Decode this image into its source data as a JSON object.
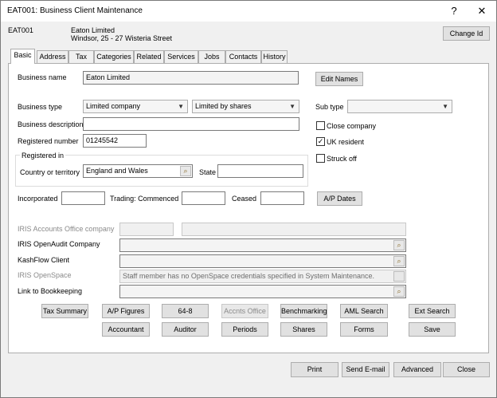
{
  "window": {
    "title": "EAT001: Business Client Maintenance",
    "help": "?",
    "close": "✕"
  },
  "header": {
    "code": "EAT001",
    "name": "Eaton Limited",
    "address": "Windsor, 25 - 27 Wisteria Street",
    "change_id": "Change Id"
  },
  "tabs": [
    "Basic",
    "Address",
    "Tax",
    "Categories",
    "Related",
    "Services",
    "Jobs",
    "Contacts",
    "History"
  ],
  "basic": {
    "business_name_label": "Business name",
    "business_name": "Eaton Limited",
    "edit_names": "Edit Names",
    "business_type_label": "Business type",
    "business_type": "Limited company",
    "business_subtype": "Limited by shares",
    "sub_type_label": "Sub type",
    "sub_type": "",
    "description_label": "Business description",
    "description": "",
    "reg_number_label": "Registered number",
    "reg_number": "01245542",
    "close_company": "Close company",
    "uk_resident": "UK resident",
    "struck_off": "Struck off",
    "registered_in_label": "Registered in",
    "country_label": "Country or territory",
    "country": "England and Wales",
    "state_label": "State",
    "state": "",
    "incorporated_label": "Incorporated",
    "incorporated": "",
    "trading_label": "Trading: Commenced",
    "trading": "",
    "ceased_label": "Ceased",
    "ceased": "",
    "ap_dates": "A/P Dates",
    "iris_accounts_label": "IRIS Accounts Office company",
    "openaudit_label": "IRIS OpenAudit Company",
    "kashflow_label": "KashFlow Client",
    "openspace_label": "IRIS OpenSpace",
    "openspace_msg": "Staff member has no OpenSpace credentials specified in System Maintenance.",
    "bookkeeping_label": "Link to Bookkeeping"
  },
  "action_buttons_row1": [
    "Tax Summary",
    "A/P Figures",
    "64-8",
    "Accnts Office",
    "Benchmarking",
    "AML Search",
    "Ext Search"
  ],
  "action_buttons_row2": [
    "Accountant",
    "Auditor",
    "Periods",
    "Shares",
    "Forms",
    "Save"
  ],
  "footer": {
    "print": "Print",
    "send_email": "Send E-mail",
    "advanced": "Advanced",
    "close": "Close"
  },
  "checks": {
    "close_company": false,
    "uk_resident": true,
    "struck_off": false
  }
}
